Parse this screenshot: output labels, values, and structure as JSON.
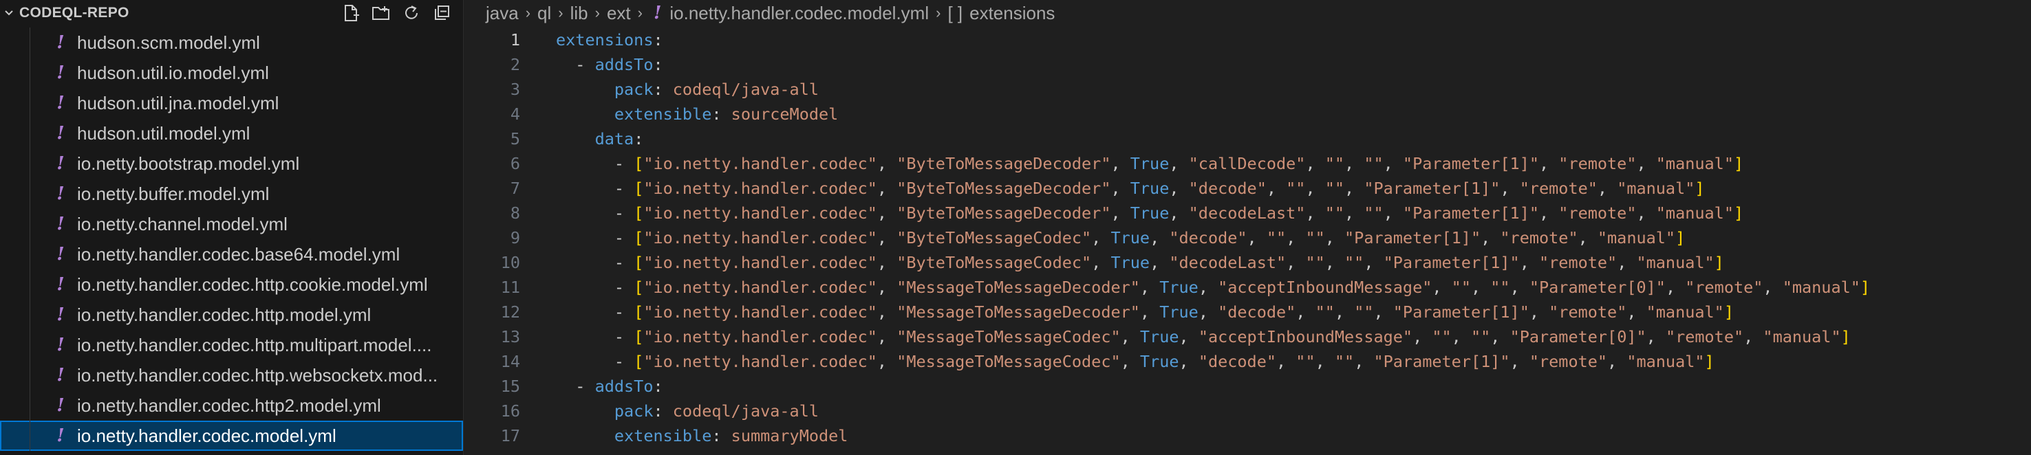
{
  "sidebar": {
    "title": "CODEQL-REPO",
    "files": [
      {
        "name": "hudson.scm.model.yml",
        "selected": false
      },
      {
        "name": "hudson.util.io.model.yml",
        "selected": false
      },
      {
        "name": "hudson.util.jna.model.yml",
        "selected": false
      },
      {
        "name": "hudson.util.model.yml",
        "selected": false
      },
      {
        "name": "io.netty.bootstrap.model.yml",
        "selected": false
      },
      {
        "name": "io.netty.buffer.model.yml",
        "selected": false
      },
      {
        "name": "io.netty.channel.model.yml",
        "selected": false
      },
      {
        "name": "io.netty.handler.codec.base64.model.yml",
        "selected": false
      },
      {
        "name": "io.netty.handler.codec.http.cookie.model.yml",
        "selected": false
      },
      {
        "name": "io.netty.handler.codec.http.model.yml",
        "selected": false
      },
      {
        "name": "io.netty.handler.codec.http.multipart.model....",
        "selected": false
      },
      {
        "name": "io.netty.handler.codec.http.websocketx.mod...",
        "selected": false
      },
      {
        "name": "io.netty.handler.codec.http2.model.yml",
        "selected": false
      },
      {
        "name": "io.netty.handler.codec.model.yml",
        "selected": true
      }
    ],
    "file_icon": "!"
  },
  "breadcrumb": {
    "parts": [
      "java",
      "ql",
      "lib",
      "ext"
    ],
    "file": "io.netty.handler.codec.model.yml",
    "symbol_icon": "[ ]",
    "symbol": "extensions"
  },
  "editor": {
    "active_line": 1,
    "lines": [
      {
        "n": "1",
        "t": [
          [
            "k",
            "extensions"
          ],
          [
            "p",
            ":"
          ]
        ]
      },
      {
        "n": "2",
        "t": [
          [
            "p",
            "  - "
          ],
          [
            "k",
            "addsTo"
          ],
          [
            "p",
            ":"
          ]
        ]
      },
      {
        "n": "3",
        "t": [
          [
            "p",
            "      "
          ],
          [
            "k",
            "pack"
          ],
          [
            "p",
            ": "
          ],
          [
            "s",
            "codeql/java-all"
          ]
        ]
      },
      {
        "n": "4",
        "t": [
          [
            "p",
            "      "
          ],
          [
            "k",
            "extensible"
          ],
          [
            "p",
            ": "
          ],
          [
            "s",
            "sourceModel"
          ]
        ]
      },
      {
        "n": "5",
        "t": [
          [
            "p",
            "    "
          ],
          [
            "k",
            "data"
          ],
          [
            "p",
            ":"
          ]
        ]
      },
      {
        "n": "6",
        "t": [
          [
            "p",
            "      - "
          ],
          [
            "br",
            "["
          ],
          [
            "s",
            "\"io.netty.handler.codec\""
          ],
          [
            "p",
            ", "
          ],
          [
            "s",
            "\"ByteToMessageDecoder\""
          ],
          [
            "p",
            ", "
          ],
          [
            "b",
            "True"
          ],
          [
            "p",
            ", "
          ],
          [
            "s",
            "\"callDecode\""
          ],
          [
            "p",
            ", "
          ],
          [
            "s",
            "\"\""
          ],
          [
            "p",
            ", "
          ],
          [
            "s",
            "\"\""
          ],
          [
            "p",
            ", "
          ],
          [
            "s",
            "\"Parameter[1]\""
          ],
          [
            "p",
            ", "
          ],
          [
            "s",
            "\"remote\""
          ],
          [
            "p",
            ", "
          ],
          [
            "s",
            "\"manual\""
          ],
          [
            "br",
            "]"
          ]
        ]
      },
      {
        "n": "7",
        "t": [
          [
            "p",
            "      - "
          ],
          [
            "br",
            "["
          ],
          [
            "s",
            "\"io.netty.handler.codec\""
          ],
          [
            "p",
            ", "
          ],
          [
            "s",
            "\"ByteToMessageDecoder\""
          ],
          [
            "p",
            ", "
          ],
          [
            "b",
            "True"
          ],
          [
            "p",
            ", "
          ],
          [
            "s",
            "\"decode\""
          ],
          [
            "p",
            ", "
          ],
          [
            "s",
            "\"\""
          ],
          [
            "p",
            ", "
          ],
          [
            "s",
            "\"\""
          ],
          [
            "p",
            ", "
          ],
          [
            "s",
            "\"Parameter[1]\""
          ],
          [
            "p",
            ", "
          ],
          [
            "s",
            "\"remote\""
          ],
          [
            "p",
            ", "
          ],
          [
            "s",
            "\"manual\""
          ],
          [
            "br",
            "]"
          ]
        ]
      },
      {
        "n": "8",
        "t": [
          [
            "p",
            "      - "
          ],
          [
            "br",
            "["
          ],
          [
            "s",
            "\"io.netty.handler.codec\""
          ],
          [
            "p",
            ", "
          ],
          [
            "s",
            "\"ByteToMessageDecoder\""
          ],
          [
            "p",
            ", "
          ],
          [
            "b",
            "True"
          ],
          [
            "p",
            ", "
          ],
          [
            "s",
            "\"decodeLast\""
          ],
          [
            "p",
            ", "
          ],
          [
            "s",
            "\"\""
          ],
          [
            "p",
            ", "
          ],
          [
            "s",
            "\"\""
          ],
          [
            "p",
            ", "
          ],
          [
            "s",
            "\"Parameter[1]\""
          ],
          [
            "p",
            ", "
          ],
          [
            "s",
            "\"remote\""
          ],
          [
            "p",
            ", "
          ],
          [
            "s",
            "\"manual\""
          ],
          [
            "br",
            "]"
          ]
        ]
      },
      {
        "n": "9",
        "t": [
          [
            "p",
            "      - "
          ],
          [
            "br",
            "["
          ],
          [
            "s",
            "\"io.netty.handler.codec\""
          ],
          [
            "p",
            ", "
          ],
          [
            "s",
            "\"ByteToMessageCodec\""
          ],
          [
            "p",
            ", "
          ],
          [
            "b",
            "True"
          ],
          [
            "p",
            ", "
          ],
          [
            "s",
            "\"decode\""
          ],
          [
            "p",
            ", "
          ],
          [
            "s",
            "\"\""
          ],
          [
            "p",
            ", "
          ],
          [
            "s",
            "\"\""
          ],
          [
            "p",
            ", "
          ],
          [
            "s",
            "\"Parameter[1]\""
          ],
          [
            "p",
            ", "
          ],
          [
            "s",
            "\"remote\""
          ],
          [
            "p",
            ", "
          ],
          [
            "s",
            "\"manual\""
          ],
          [
            "br",
            "]"
          ]
        ]
      },
      {
        "n": "10",
        "t": [
          [
            "p",
            "      - "
          ],
          [
            "br",
            "["
          ],
          [
            "s",
            "\"io.netty.handler.codec\""
          ],
          [
            "p",
            ", "
          ],
          [
            "s",
            "\"ByteToMessageCodec\""
          ],
          [
            "p",
            ", "
          ],
          [
            "b",
            "True"
          ],
          [
            "p",
            ", "
          ],
          [
            "s",
            "\"decodeLast\""
          ],
          [
            "p",
            ", "
          ],
          [
            "s",
            "\"\""
          ],
          [
            "p",
            ", "
          ],
          [
            "s",
            "\"\""
          ],
          [
            "p",
            ", "
          ],
          [
            "s",
            "\"Parameter[1]\""
          ],
          [
            "p",
            ", "
          ],
          [
            "s",
            "\"remote\""
          ],
          [
            "p",
            ", "
          ],
          [
            "s",
            "\"manual\""
          ],
          [
            "br",
            "]"
          ]
        ]
      },
      {
        "n": "11",
        "t": [
          [
            "p",
            "      - "
          ],
          [
            "br",
            "["
          ],
          [
            "s",
            "\"io.netty.handler.codec\""
          ],
          [
            "p",
            ", "
          ],
          [
            "s",
            "\"MessageToMessageDecoder\""
          ],
          [
            "p",
            ", "
          ],
          [
            "b",
            "True"
          ],
          [
            "p",
            ", "
          ],
          [
            "s",
            "\"acceptInboundMessage\""
          ],
          [
            "p",
            ", "
          ],
          [
            "s",
            "\"\""
          ],
          [
            "p",
            ", "
          ],
          [
            "s",
            "\"\""
          ],
          [
            "p",
            ", "
          ],
          [
            "s",
            "\"Parameter[0]\""
          ],
          [
            "p",
            ", "
          ],
          [
            "s",
            "\"remote\""
          ],
          [
            "p",
            ", "
          ],
          [
            "s",
            "\"manual\""
          ],
          [
            "br",
            "]"
          ]
        ]
      },
      {
        "n": "12",
        "t": [
          [
            "p",
            "      - "
          ],
          [
            "br",
            "["
          ],
          [
            "s",
            "\"io.netty.handler.codec\""
          ],
          [
            "p",
            ", "
          ],
          [
            "s",
            "\"MessageToMessageDecoder\""
          ],
          [
            "p",
            ", "
          ],
          [
            "b",
            "True"
          ],
          [
            "p",
            ", "
          ],
          [
            "s",
            "\"decode\""
          ],
          [
            "p",
            ", "
          ],
          [
            "s",
            "\"\""
          ],
          [
            "p",
            ", "
          ],
          [
            "s",
            "\"\""
          ],
          [
            "p",
            ", "
          ],
          [
            "s",
            "\"Parameter[1]\""
          ],
          [
            "p",
            ", "
          ],
          [
            "s",
            "\"remote\""
          ],
          [
            "p",
            ", "
          ],
          [
            "s",
            "\"manual\""
          ],
          [
            "br",
            "]"
          ]
        ]
      },
      {
        "n": "13",
        "t": [
          [
            "p",
            "      - "
          ],
          [
            "br",
            "["
          ],
          [
            "s",
            "\"io.netty.handler.codec\""
          ],
          [
            "p",
            ", "
          ],
          [
            "s",
            "\"MessageToMessageCodec\""
          ],
          [
            "p",
            ", "
          ],
          [
            "b",
            "True"
          ],
          [
            "p",
            ", "
          ],
          [
            "s",
            "\"acceptInboundMessage\""
          ],
          [
            "p",
            ", "
          ],
          [
            "s",
            "\"\""
          ],
          [
            "p",
            ", "
          ],
          [
            "s",
            "\"\""
          ],
          [
            "p",
            ", "
          ],
          [
            "s",
            "\"Parameter[0]\""
          ],
          [
            "p",
            ", "
          ],
          [
            "s",
            "\"remote\""
          ],
          [
            "p",
            ", "
          ],
          [
            "s",
            "\"manual\""
          ],
          [
            "br",
            "]"
          ]
        ]
      },
      {
        "n": "14",
        "t": [
          [
            "p",
            "      - "
          ],
          [
            "br",
            "["
          ],
          [
            "s",
            "\"io.netty.handler.codec\""
          ],
          [
            "p",
            ", "
          ],
          [
            "s",
            "\"MessageToMessageCodec\""
          ],
          [
            "p",
            ", "
          ],
          [
            "b",
            "True"
          ],
          [
            "p",
            ", "
          ],
          [
            "s",
            "\"decode\""
          ],
          [
            "p",
            ", "
          ],
          [
            "s",
            "\"\""
          ],
          [
            "p",
            ", "
          ],
          [
            "s",
            "\"\""
          ],
          [
            "p",
            ", "
          ],
          [
            "s",
            "\"Parameter[1]\""
          ],
          [
            "p",
            ", "
          ],
          [
            "s",
            "\"remote\""
          ],
          [
            "p",
            ", "
          ],
          [
            "s",
            "\"manual\""
          ],
          [
            "br",
            "]"
          ]
        ]
      },
      {
        "n": "15",
        "t": [
          [
            "p",
            "  - "
          ],
          [
            "k",
            "addsTo"
          ],
          [
            "p",
            ":"
          ]
        ]
      },
      {
        "n": "16",
        "t": [
          [
            "p",
            "      "
          ],
          [
            "k",
            "pack"
          ],
          [
            "p",
            ": "
          ],
          [
            "s",
            "codeql/java-all"
          ]
        ]
      },
      {
        "n": "17",
        "t": [
          [
            "p",
            "      "
          ],
          [
            "k",
            "extensible"
          ],
          [
            "p",
            ": "
          ],
          [
            "s",
            "summaryModel"
          ]
        ]
      }
    ]
  }
}
